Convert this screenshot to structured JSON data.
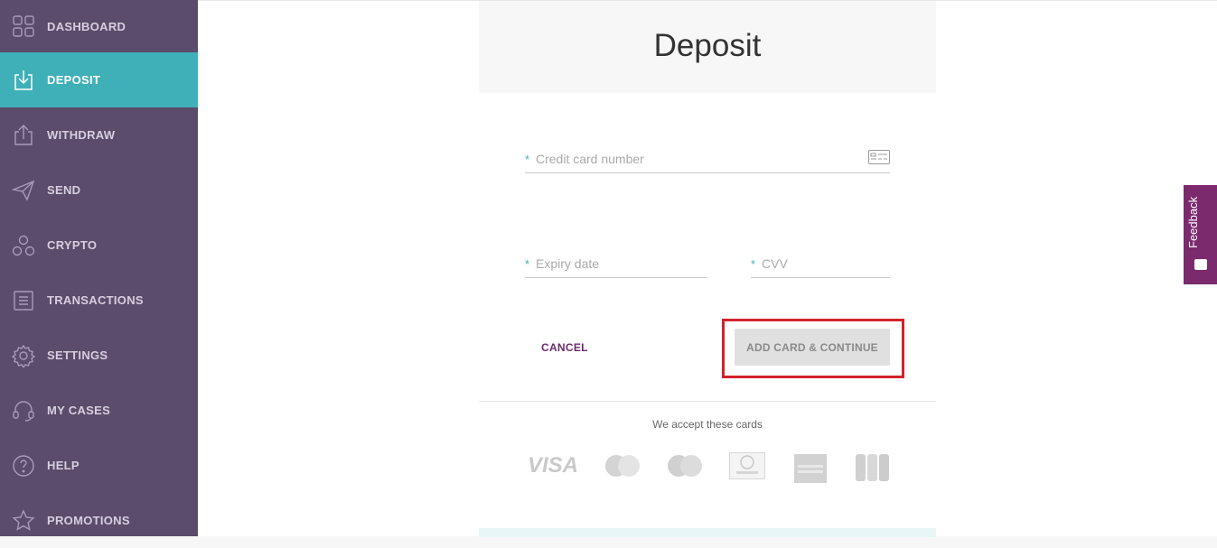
{
  "sidebar": {
    "items": [
      {
        "label": "DASHBOARD",
        "icon": "dashboard-icon",
        "active": false
      },
      {
        "label": "DEPOSIT",
        "icon": "deposit-icon",
        "active": true
      },
      {
        "label": "WITHDRAW",
        "icon": "withdraw-icon",
        "active": false
      },
      {
        "label": "SEND",
        "icon": "send-icon",
        "active": false
      },
      {
        "label": "CRYPTO",
        "icon": "crypto-icon",
        "active": false
      },
      {
        "label": "TRANSACTIONS",
        "icon": "transactions-icon",
        "active": false
      },
      {
        "label": "SETTINGS",
        "icon": "settings-icon",
        "active": false
      },
      {
        "label": "MY CASES",
        "icon": "headset-icon",
        "active": false
      },
      {
        "label": "HELP",
        "icon": "help-icon",
        "active": false
      },
      {
        "label": "PROMOTIONS",
        "icon": "star-icon",
        "active": false
      }
    ]
  },
  "page": {
    "title": "Deposit"
  },
  "form": {
    "card_number": {
      "placeholder": "Credit card number",
      "value": ""
    },
    "expiry": {
      "placeholder": "Expiry date",
      "value": ""
    },
    "cvv": {
      "placeholder": "CVV",
      "value": ""
    },
    "required_mark": "*",
    "cancel_label": "CANCEL",
    "submit_label": "ADD CARD & CONTINUE"
  },
  "accepted": {
    "text": "We accept these cards",
    "cards": [
      "VISA",
      "Mastercard",
      "Maestro",
      "Diners Club",
      "American Express",
      "JCB"
    ]
  },
  "feedback": {
    "label": "Feedback"
  },
  "colors": {
    "sidebar": "#5b4c6b",
    "active": "#3fb0b7",
    "accent": "#7b2a6e",
    "highlight": "#d2232a"
  }
}
